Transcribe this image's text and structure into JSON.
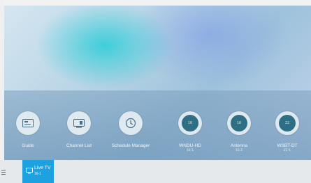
{
  "panel": {
    "items": [
      {
        "label": "Guide",
        "icon": "guide-icon"
      },
      {
        "label": "Channel List",
        "icon": "channel-list-icon"
      },
      {
        "label": "Schedule Manager",
        "icon": "schedule-clock-icon"
      },
      {
        "label": "WNDU-HD",
        "sub": "16-1",
        "badge": "16"
      },
      {
        "label": "Antenna",
        "sub": "16-2",
        "badge": "16"
      },
      {
        "label": "WSBT-DT",
        "sub": "22-1",
        "badge": "22"
      }
    ]
  },
  "bottom_bar": {
    "live_tv": {
      "title": "Live TV",
      "channel": "16-1"
    }
  },
  "colors": {
    "accent": "#1da1e0",
    "channel_circle": "#2e6f86"
  }
}
